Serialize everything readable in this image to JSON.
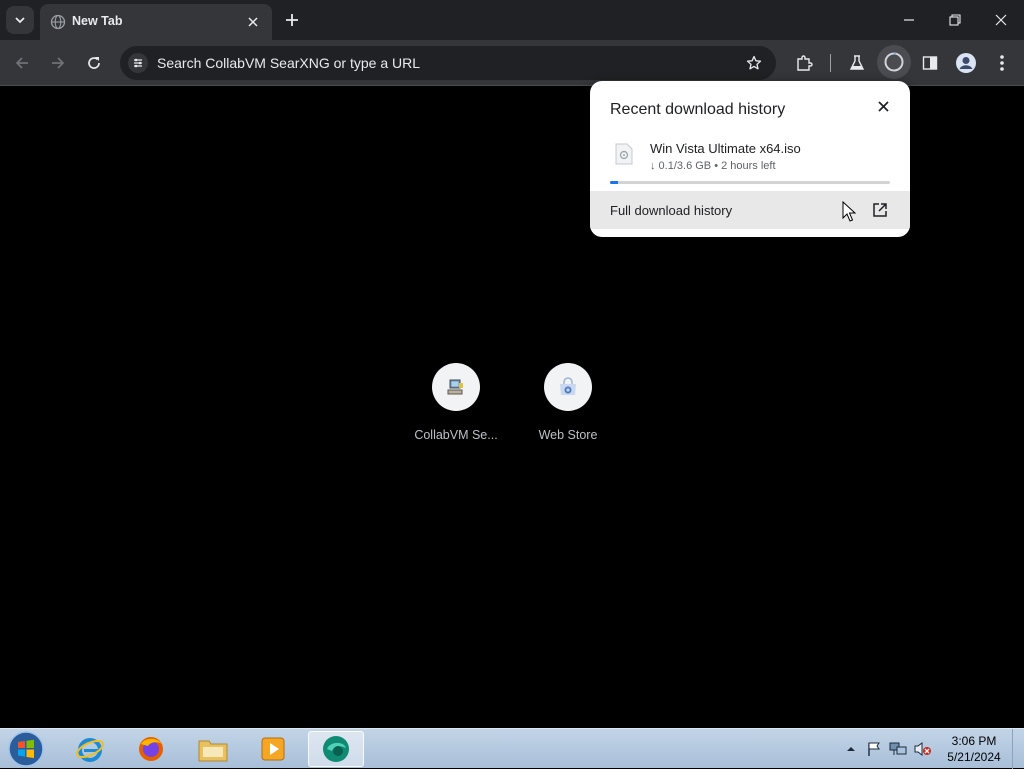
{
  "browser": {
    "tab": {
      "title": "New Tab"
    },
    "omnibox": {
      "placeholder": "Search CollabVM SearXNG or type a URL"
    }
  },
  "shortcuts": [
    {
      "label": "CollabVM Se..."
    },
    {
      "label": "Web Store"
    }
  ],
  "download_popup": {
    "heading": "Recent download history",
    "item": {
      "filename": "Win Vista Ultimate x64.iso",
      "status": "↓ 0.1/3.6 GB • 2 hours left",
      "progress_fraction": 0.028
    },
    "full_history_label": "Full download history"
  },
  "taskbar": {
    "apps": [
      "internet-explorer",
      "firefox",
      "file-explorer",
      "media-player",
      "browser-active"
    ],
    "time": "3:06 PM",
    "date": "5/21/2024"
  },
  "colors": {
    "tabstrip": "#202124",
    "toolbar": "#35363a",
    "accent": "#1a73e8",
    "page_bg": "#000000"
  }
}
